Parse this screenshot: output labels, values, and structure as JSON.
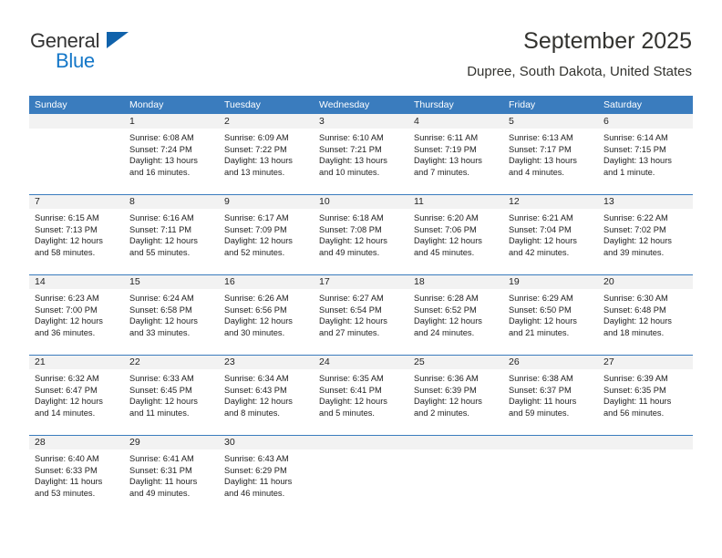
{
  "brand": {
    "name_part1": "General",
    "name_part2": "Blue",
    "accent_color": "#1477c8",
    "triangle_color": "#1062ab"
  },
  "header": {
    "title": "September 2025",
    "location": "Dupree, South Dakota, United States",
    "header_bar_color": "#3a7cbe",
    "daynum_band_color": "#f2f2f2"
  },
  "calendar": {
    "weekday_headers": [
      "Sunday",
      "Monday",
      "Tuesday",
      "Wednesday",
      "Thursday",
      "Friday",
      "Saturday"
    ],
    "weeks": [
      {
        "days": [
          {
            "num": "",
            "empty": true
          },
          {
            "num": "1",
            "sunrise": "Sunrise: 6:08 AM",
            "sunset": "Sunset: 7:24 PM",
            "daylight1": "Daylight: 13 hours",
            "daylight2": "and 16 minutes."
          },
          {
            "num": "2",
            "sunrise": "Sunrise: 6:09 AM",
            "sunset": "Sunset: 7:22 PM",
            "daylight1": "Daylight: 13 hours",
            "daylight2": "and 13 minutes."
          },
          {
            "num": "3",
            "sunrise": "Sunrise: 6:10 AM",
            "sunset": "Sunset: 7:21 PM",
            "daylight1": "Daylight: 13 hours",
            "daylight2": "and 10 minutes."
          },
          {
            "num": "4",
            "sunrise": "Sunrise: 6:11 AM",
            "sunset": "Sunset: 7:19 PM",
            "daylight1": "Daylight: 13 hours",
            "daylight2": "and 7 minutes."
          },
          {
            "num": "5",
            "sunrise": "Sunrise: 6:13 AM",
            "sunset": "Sunset: 7:17 PM",
            "daylight1": "Daylight: 13 hours",
            "daylight2": "and 4 minutes."
          },
          {
            "num": "6",
            "sunrise": "Sunrise: 6:14 AM",
            "sunset": "Sunset: 7:15 PM",
            "daylight1": "Daylight: 13 hours",
            "daylight2": "and 1 minute."
          }
        ]
      },
      {
        "days": [
          {
            "num": "7",
            "sunrise": "Sunrise: 6:15 AM",
            "sunset": "Sunset: 7:13 PM",
            "daylight1": "Daylight: 12 hours",
            "daylight2": "and 58 minutes."
          },
          {
            "num": "8",
            "sunrise": "Sunrise: 6:16 AM",
            "sunset": "Sunset: 7:11 PM",
            "daylight1": "Daylight: 12 hours",
            "daylight2": "and 55 minutes."
          },
          {
            "num": "9",
            "sunrise": "Sunrise: 6:17 AM",
            "sunset": "Sunset: 7:09 PM",
            "daylight1": "Daylight: 12 hours",
            "daylight2": "and 52 minutes."
          },
          {
            "num": "10",
            "sunrise": "Sunrise: 6:18 AM",
            "sunset": "Sunset: 7:08 PM",
            "daylight1": "Daylight: 12 hours",
            "daylight2": "and 49 minutes."
          },
          {
            "num": "11",
            "sunrise": "Sunrise: 6:20 AM",
            "sunset": "Sunset: 7:06 PM",
            "daylight1": "Daylight: 12 hours",
            "daylight2": "and 45 minutes."
          },
          {
            "num": "12",
            "sunrise": "Sunrise: 6:21 AM",
            "sunset": "Sunset: 7:04 PM",
            "daylight1": "Daylight: 12 hours",
            "daylight2": "and 42 minutes."
          },
          {
            "num": "13",
            "sunrise": "Sunrise: 6:22 AM",
            "sunset": "Sunset: 7:02 PM",
            "daylight1": "Daylight: 12 hours",
            "daylight2": "and 39 minutes."
          }
        ]
      },
      {
        "days": [
          {
            "num": "14",
            "sunrise": "Sunrise: 6:23 AM",
            "sunset": "Sunset: 7:00 PM",
            "daylight1": "Daylight: 12 hours",
            "daylight2": "and 36 minutes."
          },
          {
            "num": "15",
            "sunrise": "Sunrise: 6:24 AM",
            "sunset": "Sunset: 6:58 PM",
            "daylight1": "Daylight: 12 hours",
            "daylight2": "and 33 minutes."
          },
          {
            "num": "16",
            "sunrise": "Sunrise: 6:26 AM",
            "sunset": "Sunset: 6:56 PM",
            "daylight1": "Daylight: 12 hours",
            "daylight2": "and 30 minutes."
          },
          {
            "num": "17",
            "sunrise": "Sunrise: 6:27 AM",
            "sunset": "Sunset: 6:54 PM",
            "daylight1": "Daylight: 12 hours",
            "daylight2": "and 27 minutes."
          },
          {
            "num": "18",
            "sunrise": "Sunrise: 6:28 AM",
            "sunset": "Sunset: 6:52 PM",
            "daylight1": "Daylight: 12 hours",
            "daylight2": "and 24 minutes."
          },
          {
            "num": "19",
            "sunrise": "Sunrise: 6:29 AM",
            "sunset": "Sunset: 6:50 PM",
            "daylight1": "Daylight: 12 hours",
            "daylight2": "and 21 minutes."
          },
          {
            "num": "20",
            "sunrise": "Sunrise: 6:30 AM",
            "sunset": "Sunset: 6:48 PM",
            "daylight1": "Daylight: 12 hours",
            "daylight2": "and 18 minutes."
          }
        ]
      },
      {
        "days": [
          {
            "num": "21",
            "sunrise": "Sunrise: 6:32 AM",
            "sunset": "Sunset: 6:47 PM",
            "daylight1": "Daylight: 12 hours",
            "daylight2": "and 14 minutes."
          },
          {
            "num": "22",
            "sunrise": "Sunrise: 6:33 AM",
            "sunset": "Sunset: 6:45 PM",
            "daylight1": "Daylight: 12 hours",
            "daylight2": "and 11 minutes."
          },
          {
            "num": "23",
            "sunrise": "Sunrise: 6:34 AM",
            "sunset": "Sunset: 6:43 PM",
            "daylight1": "Daylight: 12 hours",
            "daylight2": "and 8 minutes."
          },
          {
            "num": "24",
            "sunrise": "Sunrise: 6:35 AM",
            "sunset": "Sunset: 6:41 PM",
            "daylight1": "Daylight: 12 hours",
            "daylight2": "and 5 minutes."
          },
          {
            "num": "25",
            "sunrise": "Sunrise: 6:36 AM",
            "sunset": "Sunset: 6:39 PM",
            "daylight1": "Daylight: 12 hours",
            "daylight2": "and 2 minutes."
          },
          {
            "num": "26",
            "sunrise": "Sunrise: 6:38 AM",
            "sunset": "Sunset: 6:37 PM",
            "daylight1": "Daylight: 11 hours",
            "daylight2": "and 59 minutes."
          },
          {
            "num": "27",
            "sunrise": "Sunrise: 6:39 AM",
            "sunset": "Sunset: 6:35 PM",
            "daylight1": "Daylight: 11 hours",
            "daylight2": "and 56 minutes."
          }
        ]
      },
      {
        "days": [
          {
            "num": "28",
            "sunrise": "Sunrise: 6:40 AM",
            "sunset": "Sunset: 6:33 PM",
            "daylight1": "Daylight: 11 hours",
            "daylight2": "and 53 minutes."
          },
          {
            "num": "29",
            "sunrise": "Sunrise: 6:41 AM",
            "sunset": "Sunset: 6:31 PM",
            "daylight1": "Daylight: 11 hours",
            "daylight2": "and 49 minutes."
          },
          {
            "num": "30",
            "sunrise": "Sunrise: 6:43 AM",
            "sunset": "Sunset: 6:29 PM",
            "daylight1": "Daylight: 11 hours",
            "daylight2": "and 46 minutes."
          },
          {
            "num": "",
            "empty": true
          },
          {
            "num": "",
            "empty": true
          },
          {
            "num": "",
            "empty": true
          },
          {
            "num": "",
            "empty": true
          }
        ]
      }
    ]
  }
}
